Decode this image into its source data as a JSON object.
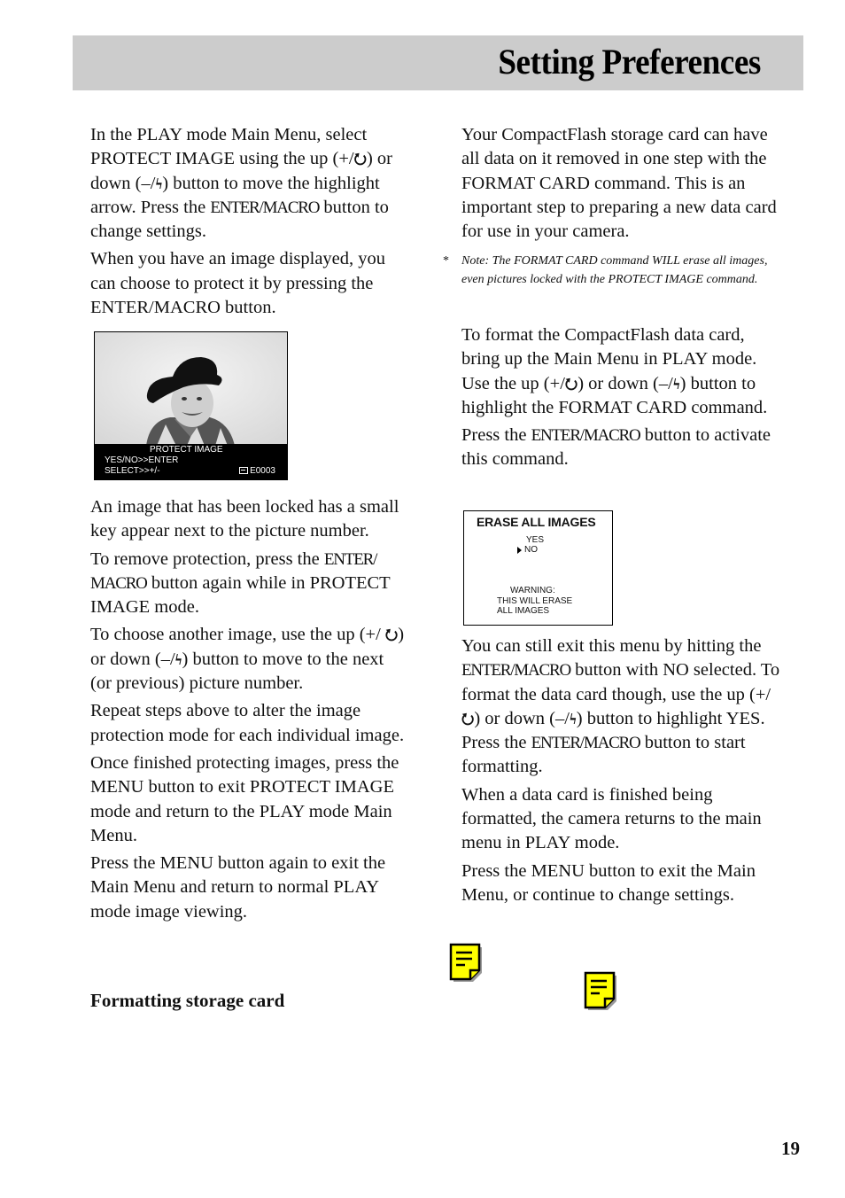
{
  "header": {
    "title": "Setting Preferences"
  },
  "left_column": {
    "paragraphs": [
      {
        "parts": [
          "In the PLAY mode Main Menu, select PROTECT IMAGE using the up (+/",
          ") or down (–/",
          ") button to move the highlight arrow. Press the ",
          " button to change settings."
        ],
        "enter_macro": "ENTER/MACRO"
      },
      {
        "text": "When you have an image displayed, you can choose to protect it by pressing the ENTER/MACRO button."
      },
      {
        "text": "An image that has been locked has a small key appear next to the picture number."
      },
      {
        "parts": [
          "To remove protection, press the ",
          " button again while in PROTECT IMAGE mode."
        ],
        "enter_macro": "ENTER/ MACRO"
      },
      {
        "parts": [
          "To choose another image, use the up (+/ ",
          ") or down (–/",
          ") button to move to the next (or previous) picture number."
        ]
      },
      {
        "text": "Repeat steps above to alter the image protection mode for each individual image."
      },
      {
        "text": "Once finished protecting images, press the MENU button to exit PROTECT IMAGE mode and return to the PLAY mode Main Menu."
      },
      {
        "text": "Press the MENU button again to exit the Main Menu and return to normal PLAY mode image viewing."
      }
    ],
    "subheading": "Formatting storage card"
  },
  "protect_screen": {
    "title": "PROTECT IMAGE",
    "line1": "YES/NO>>ENTER",
    "line2": "SELECT>>+/-",
    "picture_number": "E0003"
  },
  "right_column": {
    "paragraphs": [
      {
        "text": "Your CompactFlash storage card can have all data on it removed in one step with the FORMAT CARD command. This is an important step to preparing a new data card for use in your camera."
      },
      {
        "parts": [
          "To format the CompactFlash data card, bring up the Main Menu in PLAY mode. Use the up (+/",
          ") or down (–/",
          ") button to highlight the FORMAT CARD command."
        ]
      },
      {
        "parts": [
          "Press the ",
          " button to activate this command."
        ],
        "enter_macro": "ENTER/MACRO"
      },
      {
        "parts": [
          "You can still exit this menu by hitting the ",
          " button with NO selected. To format the data card though, use the up (+/",
          ") or down (–/",
          ") button to highlight YES. Press the ",
          " button to start formatting."
        ],
        "enter_macro": "ENTER/MACRO"
      },
      {
        "text": "When a data card is finished being formatted, the camera returns to the main menu in PLAY mode."
      },
      {
        "text": "Press the MENU button to exit the Main Menu, or continue to change settings."
      }
    ],
    "note": {
      "marker": "*",
      "text": "Note: The FORMAT CARD command WILL erase all images, even pictures locked with the PROTECT IMAGE command."
    }
  },
  "erase_menu": {
    "title": "ERASE ALL IMAGES",
    "options": [
      "YES",
      "NO"
    ],
    "selected": "NO",
    "warning_lines": [
      "WARNING:",
      "THIS WILL ERASE",
      "ALL IMAGES"
    ]
  },
  "icons": {
    "timer": "Ǯ",
    "flash": "ϟ",
    "note_icon_color": "#ffff00"
  },
  "page_number": "19"
}
